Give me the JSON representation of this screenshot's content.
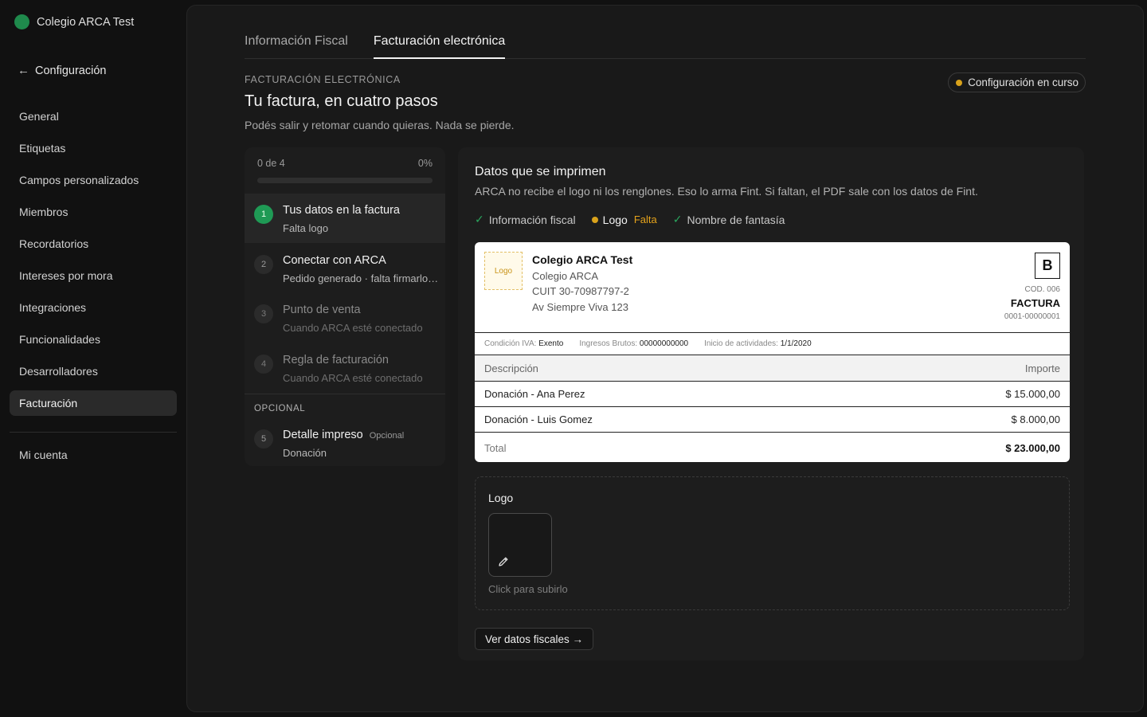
{
  "app": {
    "org_name": "Colegio ARCA Test",
    "accent": "#1f9a55",
    "warn": "#d9a21b"
  },
  "sidebar": {
    "back_label": "Configuración",
    "items": [
      {
        "label": "General"
      },
      {
        "label": "Etiquetas"
      },
      {
        "label": "Campos personalizados"
      },
      {
        "label": "Miembros"
      },
      {
        "label": "Recordatorios"
      },
      {
        "label": "Intereses por mora"
      },
      {
        "label": "Integraciones"
      },
      {
        "label": "Funcionalidades"
      },
      {
        "label": "Desarrolladores"
      },
      {
        "label": "Facturación"
      }
    ],
    "active": "Facturación",
    "account_label": "Mi cuenta"
  },
  "tabs": [
    {
      "label": "Información Fiscal"
    },
    {
      "label": "Facturación electrónica"
    }
  ],
  "header": {
    "eyebrow": "FACTURACIÓN ELECTRÓNICA",
    "title": "Tu factura, en cuatro pasos",
    "subtitle": "Podés salir y retomar cuando quieras. Nada se pierde.",
    "status": "Configuración en curso"
  },
  "steps": {
    "progress_text": "0 de 4",
    "progress_percent_text": "0%",
    "progress_fraction": 0,
    "items": [
      {
        "num": "1",
        "title": "Tus datos en la factura",
        "sub": "Falta logo"
      },
      {
        "num": "2",
        "title": "Conectar con ARCA",
        "sub": "Pedido generado · falta firmarlo en ARCA"
      },
      {
        "num": "3",
        "title": "Punto de venta",
        "sub": "Cuando ARCA esté conectado"
      },
      {
        "num": "4",
        "title": "Regla de facturación",
        "sub": "Cuando ARCA esté conectado"
      }
    ],
    "optional_label": "OPCIONAL",
    "optional_item": {
      "num": "5",
      "title": "Detalle impreso",
      "tag": "Opcional",
      "sub": "Donación"
    }
  },
  "detail": {
    "title": "Datos que se imprimen",
    "description": "ARCA no recibe el logo ni los renglones. Eso lo arma Fint. Si faltan, el PDF sale con los datos de Fint.",
    "checks": {
      "fiscal": "Información fiscal",
      "logo": "Logo",
      "logo_status": "Falta",
      "fantasy": "Nombre de fantasía"
    }
  },
  "invoice": {
    "logo_placeholder": "Logo",
    "name": "Colegio ARCA Test",
    "legal_name": "Colegio ARCA",
    "cuit": "CUIT 30-70987797-2",
    "address": "Av Siempre Viva 123",
    "letter": "B",
    "cod": "COD. 006",
    "type": "FACTURA",
    "number": "0001-00000001",
    "meta": {
      "iva_label": "Condición IVA:",
      "iva_value": "Exento",
      "ib_label": "Ingresos Brutos:",
      "ib_value": "00000000000",
      "start_label": "Inicio de actividades:",
      "start_value": "1/1/2020"
    },
    "col_desc": "Descripción",
    "col_amount": "Importe",
    "rows": [
      {
        "desc": "Donación - Ana Perez",
        "amount": "$ 15.000,00"
      },
      {
        "desc": "Donación - Luis Gomez",
        "amount": "$ 8.000,00"
      }
    ],
    "total_label": "Total",
    "total_amount": "$ 23.000,00"
  },
  "upload": {
    "title": "Logo",
    "hint": "Click para subirlo",
    "icon": "pencil-icon"
  },
  "fiscal_button": "Ver datos fiscales →"
}
